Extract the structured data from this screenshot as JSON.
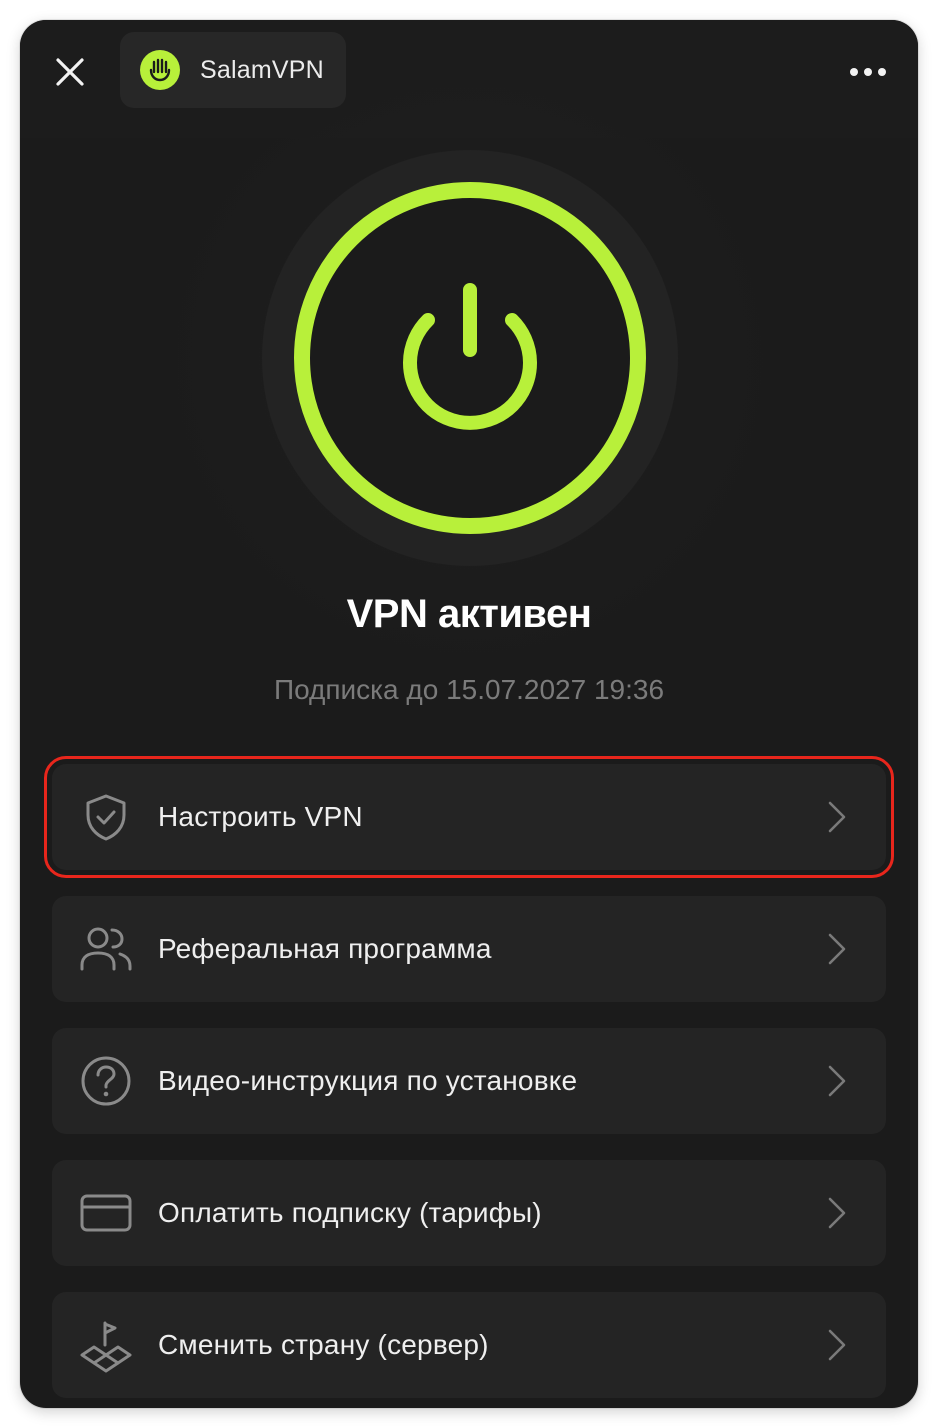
{
  "colors": {
    "accent": "#b8f03a",
    "background": "#1b1b1b",
    "card": "#242424",
    "highlight_border": "#e8261c",
    "muted_text": "#7b7b7b"
  },
  "header": {
    "close_icon": "close-icon",
    "app_name": "SalamVPN",
    "app_logo_icon": "hand-logo-icon",
    "more_icon": "more-horizontal-icon"
  },
  "status": {
    "power_icon": "power-icon",
    "title": "VPN активен",
    "subscription": "Подписка до 15.07.2027 19:36"
  },
  "menu": {
    "items": [
      {
        "label": "Настроить VPN",
        "icon": "shield-check-icon",
        "highlighted": true
      },
      {
        "label": "Реферальная программа",
        "icon": "users-icon",
        "highlighted": false
      },
      {
        "label": "Видео-инструкция по установке",
        "icon": "question-circle-icon",
        "highlighted": false
      },
      {
        "label": "Оплатить подписку (тарифы)",
        "icon": "credit-card-icon",
        "highlighted": false
      },
      {
        "label": "Сменить страну (сервер)",
        "icon": "map-flag-icon",
        "highlighted": false
      }
    ]
  }
}
